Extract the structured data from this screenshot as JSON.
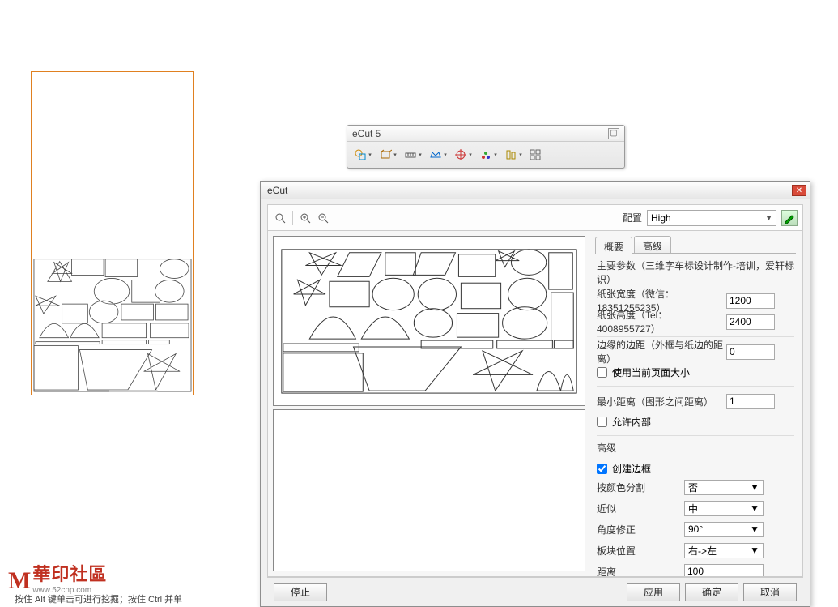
{
  "toolbar5": {
    "title": "eCut 5"
  },
  "dialog": {
    "title": "eCut",
    "profile_label": "配置",
    "profile_value": "High",
    "tabs": {
      "overview": "概要",
      "advanced": "高级"
    },
    "main_heading": "主要参数（三维字车标设计制作-培训，爱轩标识）",
    "paper_width_label": "纸张宽度（微信：18351255235）",
    "paper_width_value": "1200",
    "paper_height_label": "纸张高度（Tel：4008955727）",
    "paper_height_value": "2400",
    "border_margin_label": "边缘的边距（外框与纸边的距离）",
    "border_margin_value": "0",
    "use_page_size_label": "使用当前页面大小",
    "min_dist_label": "最小距离（图形之间距离）",
    "min_dist_value": "1",
    "allow_inner_label": "允许内部",
    "adv_heading": "高级",
    "create_border_label": "创建边框",
    "split_color_label": "按颜色分割",
    "split_color_value": "否",
    "approx_label": "近似",
    "approx_value": "中",
    "angle_label": "角度修正",
    "angle_value": "90°",
    "plate_pos_label": "板块位置",
    "plate_pos_value": "右->左",
    "distance_label": "距离",
    "distance_value": "100",
    "btn_stop": "停止",
    "btn_apply": "应用",
    "btn_ok": "确定",
    "btn_cancel": "取消"
  },
  "watermark": {
    "cn": "華印社區",
    "url": "www.52cnp.com"
  },
  "status_fragment": "按住 Alt 键单击可进行挖掘；按住 Ctrl 并单"
}
